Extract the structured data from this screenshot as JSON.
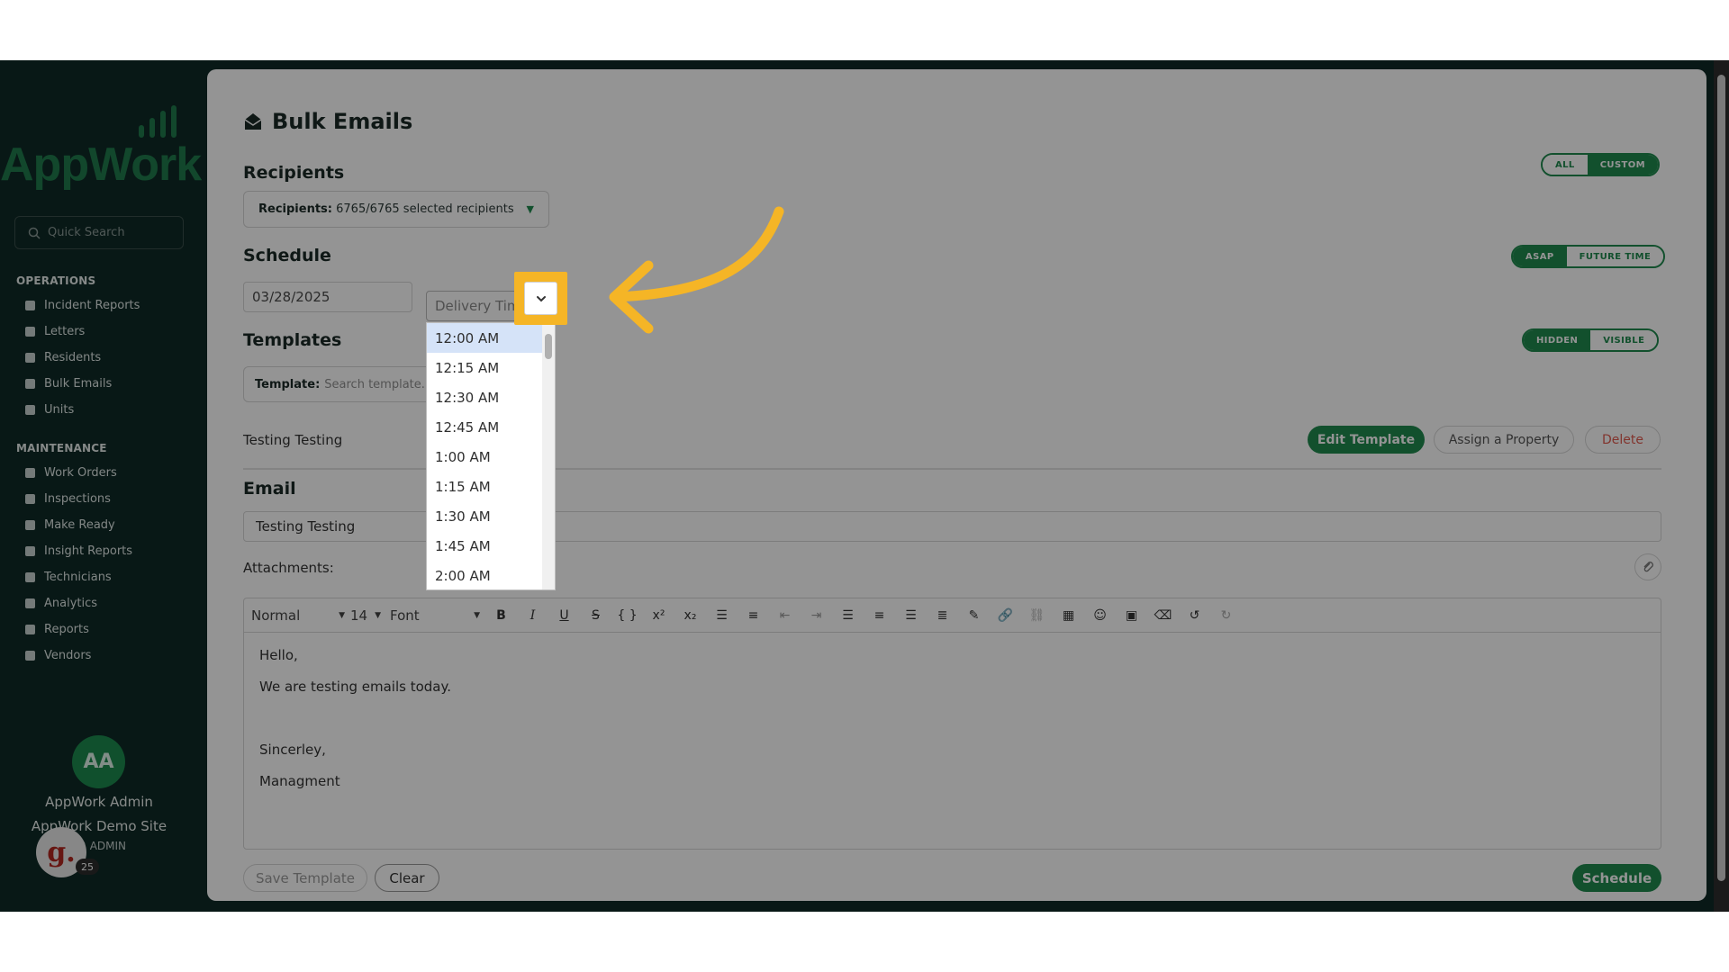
{
  "sidebar": {
    "logo": "AppWork",
    "search_placeholder": "Quick Search",
    "section_operations": "OPERATIONS",
    "operations": [
      {
        "label": "Incident Reports",
        "icon": "document-icon"
      },
      {
        "label": "Letters",
        "icon": "letter-icon"
      },
      {
        "label": "Residents",
        "icon": "people-icon"
      },
      {
        "label": "Bulk Emails",
        "icon": "envelope-icon"
      },
      {
        "label": "Units",
        "icon": "home-icon"
      }
    ],
    "section_maintenance": "MAINTENANCE",
    "maintenance": [
      {
        "label": "Work Orders",
        "icon": "wrench-icon"
      },
      {
        "label": "Inspections",
        "icon": "clipboard-icon"
      },
      {
        "label": "Make Ready",
        "icon": "box-icon"
      },
      {
        "label": "Insight Reports",
        "icon": "report-icon"
      },
      {
        "label": "Technicians",
        "icon": "helmet-icon"
      },
      {
        "label": "Analytics",
        "icon": "chart-icon"
      },
      {
        "label": "Reports",
        "icon": "file-icon"
      },
      {
        "label": "Vendors",
        "icon": "person-icon"
      }
    ],
    "user": {
      "initials": "AA",
      "name": "AppWork Admin",
      "site": "AppWork Demo Site",
      "role": "ER ADMIN"
    },
    "badge": {
      "letter": "g.",
      "count": "25"
    }
  },
  "main": {
    "title": "Bulk Emails",
    "recipients": {
      "heading": "Recipients",
      "toggle_all": "ALL",
      "toggle_custom": "CUSTOM",
      "label": "Recipients:",
      "value": "6765/6765 selected recipients"
    },
    "schedule": {
      "heading": "Schedule",
      "toggle_asap": "ASAP",
      "toggle_future": "FUTURE TIME",
      "date": "03/28/2025",
      "time_placeholder": "Delivery Time",
      "time_options": [
        "12:00 AM",
        "12:15 AM",
        "12:30 AM",
        "12:45 AM",
        "1:00 AM",
        "1:15 AM",
        "1:30 AM",
        "1:45 AM",
        "2:00 AM"
      ],
      "selected_option": "12:00 AM"
    },
    "templates": {
      "heading": "Templates",
      "toggle_hidden": "HIDDEN",
      "toggle_visible": "VISIBLE",
      "label": "Template:",
      "placeholder": "Search template...",
      "current": "Testing Testing",
      "edit_btn": "Edit Template",
      "assign_btn": "Assign a Property",
      "delete_btn": "Delete"
    },
    "email": {
      "heading": "Email",
      "subject": "Testing Testing",
      "attachments_label": "Attachments:"
    },
    "editor": {
      "style": "Normal",
      "size": "14",
      "font": "Font",
      "lines": [
        "Hello,",
        "We are testing emails today.",
        "",
        "Sincerley,",
        "Managment"
      ]
    },
    "actions": {
      "save_template": "Save Template",
      "clear": "Clear",
      "schedule": "Schedule"
    }
  },
  "colors": {
    "brand_green": "#1f8a4f",
    "sidebar_bg": "#0f2a26",
    "highlight": "#f5b526"
  }
}
